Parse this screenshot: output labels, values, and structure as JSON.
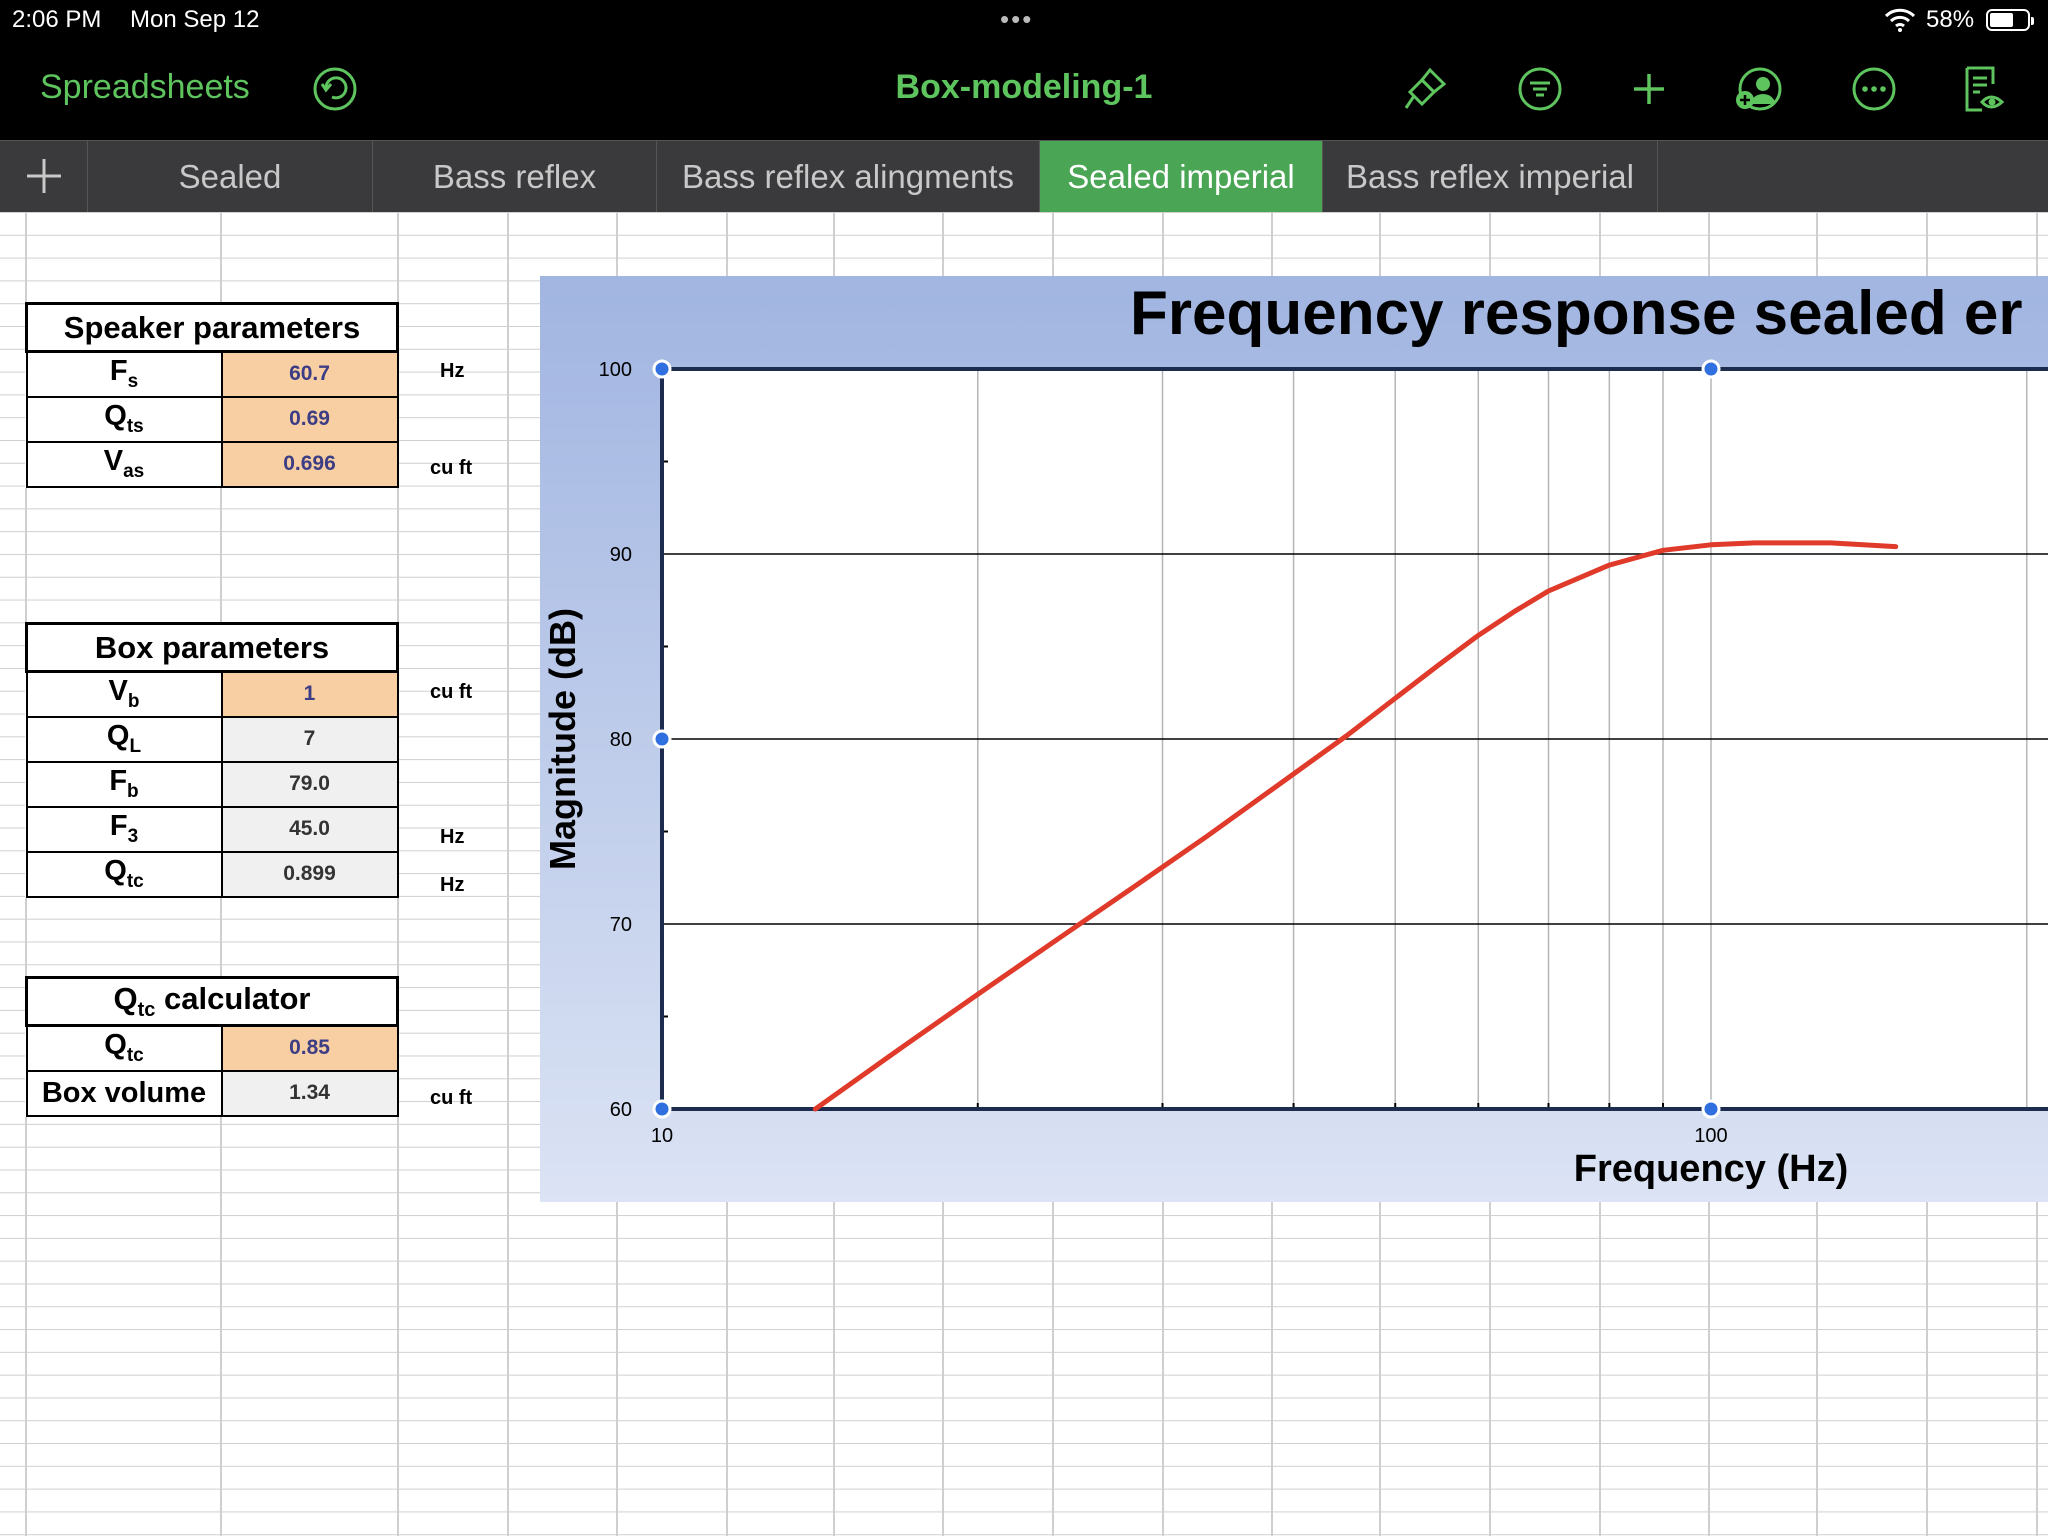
{
  "status_bar": {
    "time": "2:06 PM",
    "date": "Mon Sep 12",
    "battery": "58%",
    "battery_level": 0.58
  },
  "toolbar": {
    "back_label": "Spreadsheets",
    "document_title": "Box-modeling-1",
    "icons": [
      "undo-icon",
      "paintbrush-icon",
      "filter-icon",
      "plus-icon",
      "collaborate-icon",
      "more-icon",
      "reader-view-icon"
    ]
  },
  "tabs": [
    {
      "label": "Sealed",
      "active": false
    },
    {
      "label": "Bass reflex",
      "active": false
    },
    {
      "label": "Bass reflex alingments",
      "active": false
    },
    {
      "label": "Sealed imperial",
      "active": true
    },
    {
      "label": "Bass reflex imperial",
      "active": false
    }
  ],
  "speaker_parameters": {
    "header": "Speaker parameters",
    "rows": [
      {
        "label": "F",
        "sub": "s",
        "value": "60.7",
        "unit": "Hz"
      },
      {
        "label": "Q",
        "sub": "ts",
        "value": "0.69",
        "unit": ""
      },
      {
        "label": "V",
        "sub": "as",
        "value": "0.696",
        "unit": "cu ft"
      }
    ]
  },
  "box_parameters": {
    "header": "Box parameters",
    "rows": [
      {
        "label": "V",
        "sub": "b",
        "value": "1",
        "unit": "cu ft"
      },
      {
        "label": "Q",
        "sub": "L",
        "value": "7",
        "unit": ""
      },
      {
        "label": "F",
        "sub": "b",
        "value": "79.0",
        "unit": "Hz"
      },
      {
        "label": "F",
        "sub": "3",
        "value": "45.0",
        "unit": "Hz"
      },
      {
        "label": "Q",
        "sub": "tc",
        "value": "0.899",
        "unit": ""
      }
    ]
  },
  "qtc_calculator": {
    "header_main": "Q",
    "header_sub": "tc",
    "header_rest": " calculator",
    "rows": [
      {
        "label": "Q",
        "sub": "tc",
        "value": "0.85",
        "unit": ""
      },
      {
        "label": "Box volume",
        "sub": "",
        "value": "1.34",
        "unit": "cu ft"
      }
    ]
  },
  "colors": {
    "accent_green": "#5ec45e",
    "active_tab": "#4aa655",
    "input_cell": "#f7cfa2",
    "curve": "#e03a2a"
  },
  "chart_data": {
    "type": "line",
    "title": "Frequency response sealed er",
    "xlabel": "Frequency (Hz)",
    "ylabel": "Magnitude (dB)",
    "x_scale": "log",
    "xlim": [
      10,
      150
    ],
    "ylim": [
      60,
      100
    ],
    "x_ticks": [
      10,
      100
    ],
    "y_ticks": [
      60,
      70,
      80,
      90,
      100
    ],
    "grid": true,
    "series": [
      {
        "x": [
          14,
          17,
          20,
          24,
          28,
          33,
          38,
          45,
          50,
          55,
          60,
          65,
          70,
          80,
          90,
          100,
          110,
          120,
          130,
          150
        ],
        "y": [
          60.0,
          63.4,
          66.2,
          69.3,
          71.9,
          74.7,
          77.2,
          80.2,
          82.2,
          84.0,
          85.6,
          86.9,
          88.0,
          89.4,
          90.2,
          90.5,
          90.6,
          90.6,
          90.6,
          90.4
        ]
      }
    ]
  }
}
